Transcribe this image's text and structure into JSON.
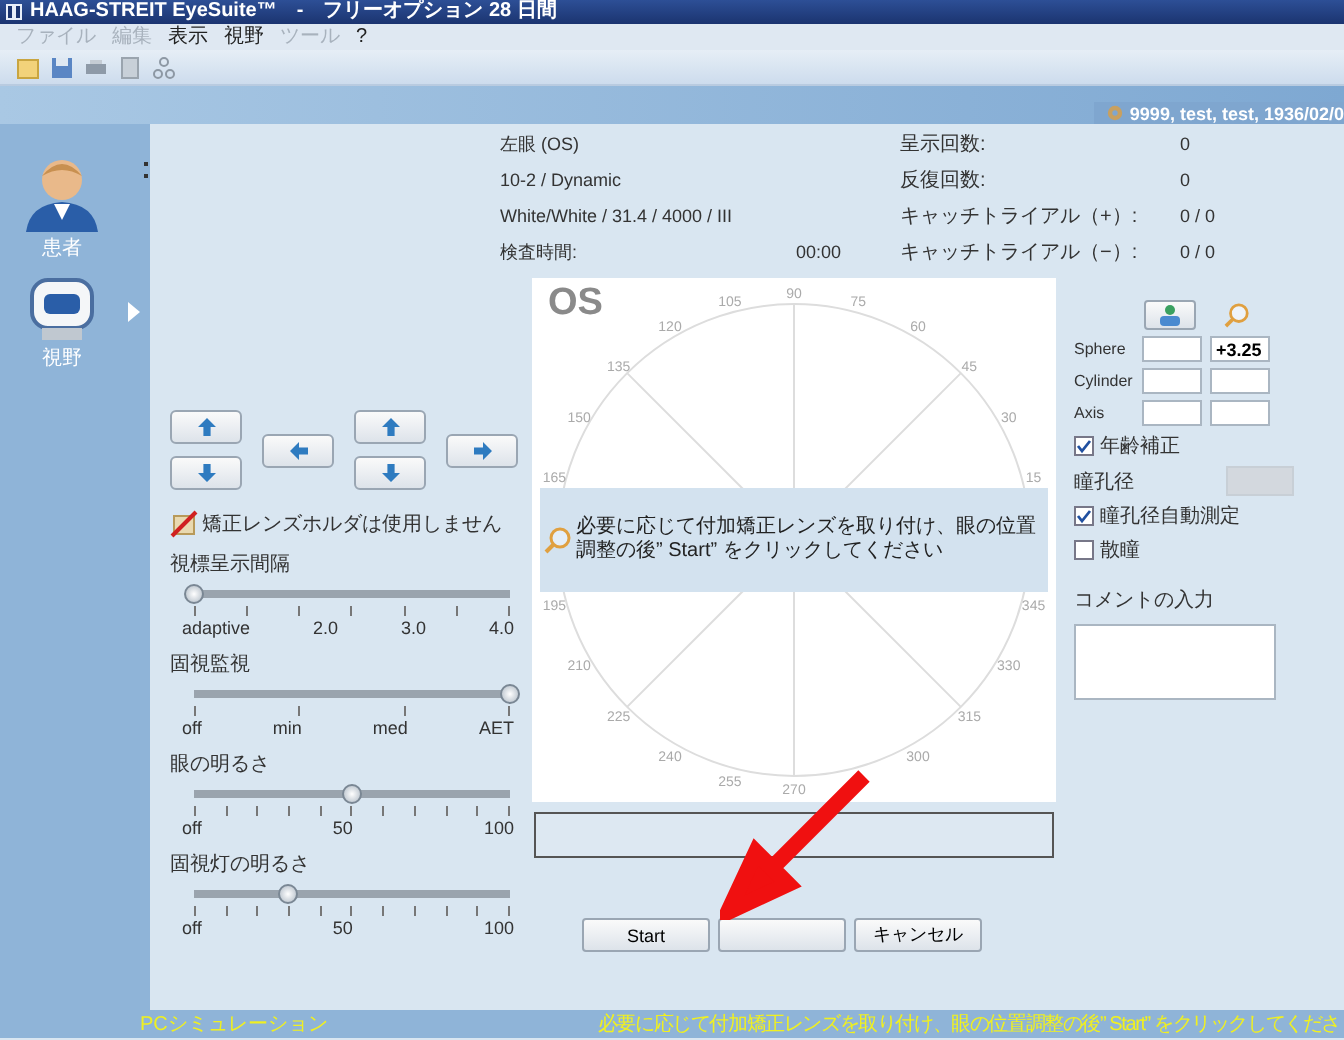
{
  "window": {
    "title": "HAAG-STREIT EyeSuite™　-　フリーオプション 28 日間"
  },
  "menu": [
    {
      "label": "ファイル",
      "disabled": true
    },
    {
      "label": "編集",
      "disabled": true
    },
    {
      "label": "表示",
      "disabled": false
    },
    {
      "label": "視野",
      "disabled": false
    },
    {
      "label": "ツール",
      "disabled": true
    },
    {
      "label": "?",
      "disabled": false
    }
  ],
  "patient_bar": {
    "text": "9999, test, test, 1936/02/0"
  },
  "sidebar": {
    "items": [
      {
        "kind": "patient",
        "label": "患者"
      },
      {
        "kind": "perimetry",
        "label": "視野"
      }
    ]
  },
  "exam_info": {
    "left": [
      {
        "label": "左眼 (OS)"
      },
      {
        "label": "10-2 / Dynamic"
      },
      {
        "label": "White/White / 31.4 / 4000 / III"
      },
      {
        "label": "検査時間:",
        "value": "00:00"
      }
    ],
    "right": [
      {
        "label": "呈示回数:",
        "value": "0"
      },
      {
        "label": "反復回数:",
        "value": "0"
      },
      {
        "label": "キャッチトライアル（+）:",
        "value": "0 / 0"
      },
      {
        "label": "キャッチトライアル（−）:",
        "value": "0 / 0"
      }
    ]
  },
  "lens_holder": {
    "label": "矯正レンズホルダは使用しません"
  },
  "sliders": [
    {
      "label": "視標呈示間隔",
      "level": 0,
      "ticks": [
        "adaptive",
        "2.0",
        "3.0",
        "4.0"
      ]
    },
    {
      "label": "固視監視",
      "level": 1,
      "ticks": [
        "off",
        "min",
        "med",
        "AET"
      ]
    },
    {
      "label": "眼の明るさ",
      "level": 0.5,
      "ticks": [
        "off",
        "50",
        "100"
      ]
    },
    {
      "label": "固視灯の明るさ",
      "level": 0.3,
      "ticks": [
        "off",
        "50",
        "100"
      ]
    }
  ],
  "chart": {
    "eye": "OS",
    "angle_labels": [
      "15",
      "30",
      "45",
      "60",
      "75",
      "90",
      "105",
      "120",
      "135",
      "150",
      "165",
      "195",
      "210",
      "225",
      "240",
      "255",
      "270",
      "300",
      "315",
      "330",
      "345"
    ],
    "message": "必要に応じて付加矯正レンズを取り付け、眼の位置調整の後” Start” をクリックしてください"
  },
  "buttons": [
    {
      "kind": "text",
      "label": "Start"
    },
    {
      "kind": "blank"
    },
    {
      "kind": "text",
      "label": "キャンセル"
    }
  ],
  "refraction": [
    {
      "label": "Sphere",
      "value": "+3.25"
    },
    {
      "label": "Cylinder"
    },
    {
      "label": "Axis"
    }
  ],
  "options": [
    {
      "kind": "checkbox",
      "label": "年齢補正",
      "checked": true
    },
    {
      "kind": "field",
      "label": "瞳孔径",
      "disabled": true
    },
    {
      "kind": "checkbox",
      "label": "瞳孔径自動測定",
      "checked": true
    },
    {
      "kind": "checkbox",
      "label": "散瞳",
      "checked": false
    }
  ],
  "comment": {
    "label": "コメントの入力"
  },
  "status_bar": {
    "mode": "PCシミュレーション",
    "message": "必要に応じて付加矯正レンズを取り付け、眼の位置調整の後” Start” をクリックしてくださ"
  }
}
